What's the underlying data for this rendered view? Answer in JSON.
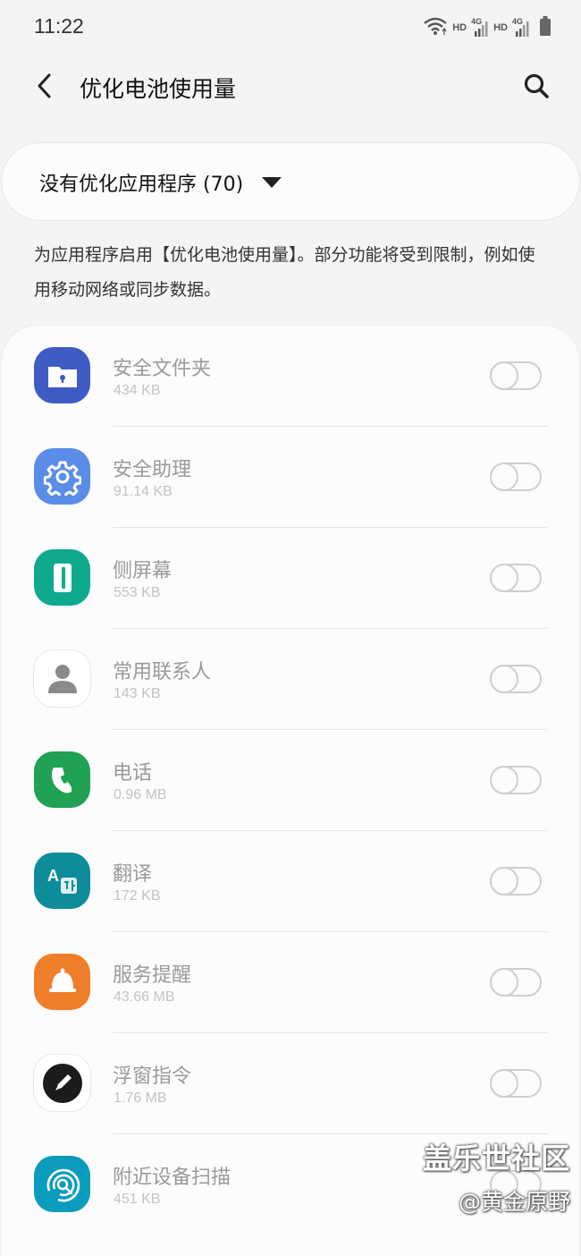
{
  "status_bar": {
    "time": "11:22",
    "network": [
      {
        "hd": "HD",
        "gen": "4G"
      },
      {
        "hd": "HD",
        "gen": "4G"
      }
    ]
  },
  "header": {
    "title": "优化电池使用量"
  },
  "filter": {
    "label": "没有优化应用程序 (70)"
  },
  "description": "为应用程序启用【优化电池使用量】。部分功能将受到限制，例如使用移动网络或同步数据。",
  "apps": [
    {
      "name": "安全文件夹",
      "size": "434 KB",
      "icon": "secure-folder-icon",
      "color": "#3f5bc4",
      "enabled": false
    },
    {
      "name": "安全助理",
      "size": "91.14 KB",
      "icon": "gear-icon",
      "color": "#5b8de8",
      "enabled": false
    },
    {
      "name": "侧屏幕",
      "size": "553 KB",
      "icon": "edge-screen-icon",
      "color": "#0faa8e",
      "enabled": false
    },
    {
      "name": "常用联系人",
      "size": "143 KB",
      "icon": "contact-person-icon",
      "color": "#ffffff",
      "enabled": false
    },
    {
      "name": "电话",
      "size": "0.96 MB",
      "icon": "phone-icon",
      "color": "#21a153",
      "enabled": false
    },
    {
      "name": "翻译",
      "size": "172 KB",
      "icon": "translate-icon",
      "color": "#0e8c9a",
      "enabled": false
    },
    {
      "name": "服务提醒",
      "size": "43.66 MB",
      "icon": "bell-icon",
      "color": "#ef7e2a",
      "enabled": false
    },
    {
      "name": "浮窗指令",
      "size": "1.76 MB",
      "icon": "pen-icon",
      "color": "#ffffff",
      "enabled": false
    },
    {
      "name": "附近设备扫描",
      "size": "451 KB",
      "icon": "nearby-scan-icon",
      "color": "#0b9bbd",
      "enabled": false
    }
  ],
  "watermark": {
    "line1": "盖乐世社区",
    "line2": "@黄金原野"
  }
}
